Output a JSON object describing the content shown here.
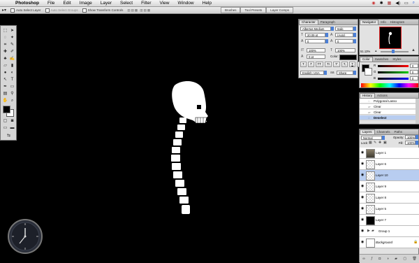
{
  "menubar": {
    "app_name": "Photoshop",
    "menus": [
      "File",
      "Edit",
      "Image",
      "Layer",
      "Select",
      "Filter",
      "View",
      "Window",
      "Help"
    ]
  },
  "options": {
    "auto_select_layer": "Auto Select Layer",
    "auto_select_groups": "Auto Select Groups",
    "show_transform_controls": "Show Transform Controls"
  },
  "palette_well": {
    "tabs": [
      "Brushes",
      "Tool Presets",
      "Layer Comps"
    ]
  },
  "character": {
    "tabs": [
      "Character",
      "Paragraph"
    ],
    "font_family": "Albertus Medium",
    "font_style": "Italic",
    "font_size": "20.09 pt",
    "leading": "(Auto)",
    "kerning": "0",
    "tracking": "0",
    "vertical_scale": "100%",
    "horizontal_scale": "100%",
    "baseline_shift": "0 pt",
    "color_label": "Color:",
    "style_buttons": [
      "T",
      "T",
      "TT",
      "Tr",
      "T'",
      "T,",
      "T",
      "F"
    ],
    "language": "English: USA",
    "anti_alias": "Sharp"
  },
  "navigator": {
    "tabs": [
      "Navigator",
      "Info",
      "Histogram"
    ],
    "zoom": "51.13%"
  },
  "color": {
    "tabs": [
      "Color",
      "Swatches",
      "Styles"
    ],
    "channels": [
      {
        "label": "R",
        "value": "0"
      },
      {
        "label": "G",
        "value": "0"
      },
      {
        "label": "B",
        "value": "0"
      }
    ]
  },
  "history": {
    "tabs": [
      "History",
      "Actions"
    ],
    "items": [
      "Polygonal Lasso",
      "Clear",
      "Clear",
      "Deselect"
    ],
    "selected_index": 3
  },
  "layers": {
    "tabs": [
      "Layers",
      "Channels",
      "Paths"
    ],
    "blend_mode": "Normal",
    "opacity_label": "Opacity:",
    "opacity": "100%",
    "lock_label": "Lock:",
    "fill_label": "Fill:",
    "fill": "100%",
    "rows": [
      {
        "name": "Layer 1",
        "thumb": "image"
      },
      {
        "name": "Layer 6",
        "thumb": "transparent"
      },
      {
        "name": "Layer 10",
        "thumb": "transparent",
        "selected": true
      },
      {
        "name": "Layer 9",
        "thumb": "transparent"
      },
      {
        "name": "Layer 8",
        "thumb": "transparent"
      },
      {
        "name": "Layer 5",
        "thumb": "transparent"
      },
      {
        "name": "Layer 7",
        "thumb": "black"
      },
      {
        "name": "Group 1",
        "thumb": "folder"
      },
      {
        "name": "Background",
        "thumb": "white",
        "italic": true
      }
    ]
  },
  "colors": {
    "accent": "#4b7fd6",
    "selection": "#b8cdf0",
    "canvas": "#000000"
  }
}
